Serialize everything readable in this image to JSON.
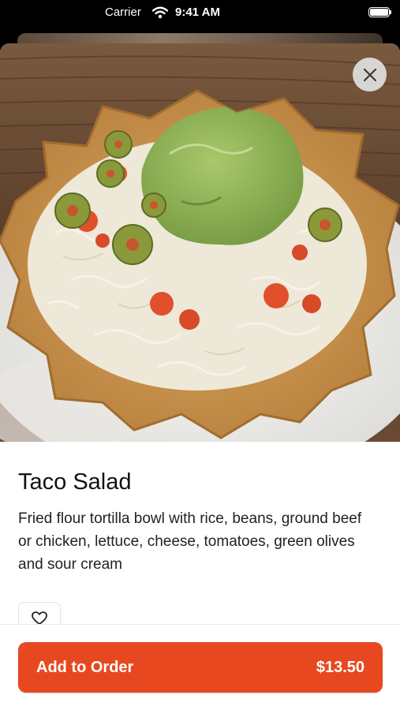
{
  "status_bar": {
    "carrier": "Carrier",
    "time": "9:41 AM"
  },
  "hero": {
    "icon": "taco-salad-photo"
  },
  "close_button": {
    "icon": "close-icon"
  },
  "item": {
    "title": "Taco Salad",
    "description": "Fried flour tortilla bowl with rice, beans, ground beef or chicken, lettuce, cheese, tomatoes, green olives and sour cream"
  },
  "favorite_button": {
    "icon": "heart-icon"
  },
  "order_button": {
    "label": "Add to Order",
    "price": "$13.50",
    "color": "#e8481f"
  }
}
